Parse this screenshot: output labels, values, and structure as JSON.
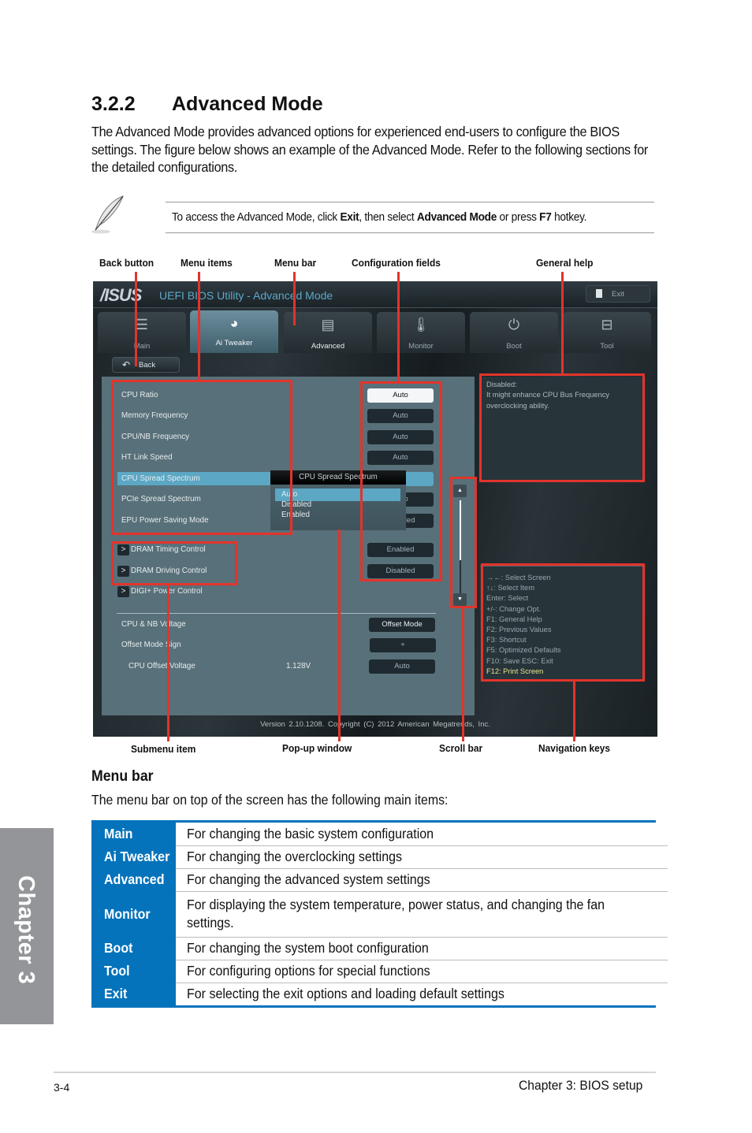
{
  "section": {
    "number": "3.2.2",
    "title": "Advanced Mode",
    "intro": "The Advanced Mode provides advanced options for experienced end-users to configure the BIOS settings. The figure below shows an example of the Advanced Mode. Refer to the following sections for the detailed configurations."
  },
  "note": {
    "icon": "feather-pen-icon",
    "text_parts": [
      "To access the Advanced Mode, click ",
      "Exit",
      ", then select ",
      "Advanced Mode",
      " or press ",
      "F7",
      " hotkey."
    ]
  },
  "callouts": {
    "top": [
      "Back button",
      "Menu items",
      "Menu bar",
      "Configuration fields",
      "General help"
    ],
    "bottom": [
      "Submenu item",
      "Pop-up window",
      "Scroll bar",
      "Navigation keys"
    ]
  },
  "bios": {
    "logo": "/ISUS",
    "title": "UEFI BIOS Utility - Advanced Mode",
    "exit_label": "Exit",
    "tabs": [
      {
        "label": "Main",
        "icon": "list-icon",
        "glyph": "☰",
        "active": false
      },
      {
        "label": "Ai  Tweaker",
        "icon": "tweaker-icon",
        "glyph": "◕",
        "active": true
      },
      {
        "label": "Advanced",
        "icon": "advanced-icon",
        "glyph": "▤",
        "active": false
      },
      {
        "label": "Monitor",
        "icon": "thermometer-icon",
        "glyph": "🌡",
        "active": false
      },
      {
        "label": "Boot",
        "icon": "power-icon",
        "glyph": "⏻",
        "active": false
      },
      {
        "label": "Tool",
        "icon": "toolbox-icon",
        "glyph": "⊟",
        "active": false
      }
    ],
    "back_label": "Back",
    "items": [
      {
        "label": "CPU Ratio",
        "value": "Auto"
      },
      {
        "label": "Memory Frequency",
        "value": "Auto"
      },
      {
        "label": "CPU/NB Frequency",
        "value": "Auto"
      },
      {
        "label": "HT Link Speed",
        "value": "Auto"
      },
      {
        "label": "CPU Spread Spectrum",
        "value": ""
      },
      {
        "label": "PCIe Spread Spectrum",
        "value": "Auto"
      },
      {
        "label": "EPU Power Saving Mode",
        "value": "Disabled"
      }
    ],
    "submenus": [
      {
        "label": "DRAM Timing Control",
        "value": "Enabled"
      },
      {
        "label": "DRAM Driving Control",
        "value": "Disabled"
      },
      {
        "label": "DIGI+ Power Control",
        "value": ""
      }
    ],
    "submenu_arrow": ">",
    "voltage": [
      {
        "label": "CPU & NB Voltage",
        "reading": "",
        "value": "Offset Mode"
      },
      {
        "label": "Offset Mode Sign",
        "reading": "",
        "value": "+"
      },
      {
        "label": "CPU Offset Voltage",
        "reading": "1.128V",
        "value": "Auto"
      }
    ],
    "popup": {
      "title": "CPU Spread Spectrum",
      "options": [
        "Auto",
        "Disabled",
        "Enabled"
      ],
      "selected": "Auto"
    },
    "scrollbar": {
      "position_fraction": 0.0,
      "visible_fraction": 0.62
    },
    "help": {
      "lines": [
        "Disabled:",
        "It might enhance CPU Bus Frequency",
        "overclocking ability."
      ]
    },
    "nav_keys": [
      "→←:  Select Screen",
      "↑↓:  Select Item",
      "Enter:  Select",
      "+/-:  Change Opt.",
      "F1:  General Help",
      "F2:  Previous Values",
      "F3:  Shortcut",
      "F5:  Optimized Defaults",
      "F10:  Save    ESC:  Exit",
      "F12: Print Screen"
    ],
    "version": "Version  2.10.1208.  Copyright  (C)  2012  American  Megatrends,  Inc.",
    "colors": {
      "highlight": "#5ba7c4",
      "panel": "#587079",
      "f12": "#e6e28a",
      "callout": "#e2342c"
    }
  },
  "menu_bar": {
    "heading": "Menu bar",
    "description": "The menu bar on top of the screen has the following main items:",
    "rows": [
      {
        "item": "Main",
        "desc": "For changing the basic system configuration"
      },
      {
        "item": "Ai Tweaker",
        "desc": "For changing the overclocking settings"
      },
      {
        "item": "Advanced",
        "desc": "For changing the advanced system settings"
      },
      {
        "item": "Monitor",
        "desc": "For displaying the system temperature, power status, and changing the fan settings."
      },
      {
        "item": "Boot",
        "desc": "For changing the system boot configuration"
      },
      {
        "item": "Tool",
        "desc": "For configuring options for special functions"
      },
      {
        "item": "Exit",
        "desc": "For selecting the exit options and loading default settings"
      }
    ],
    "accent": "#0573bb"
  },
  "footer": {
    "chapter_tab": "Chapter 3",
    "page_number": "3-4",
    "chapter_title": "Chapter 3: BIOS setup"
  }
}
